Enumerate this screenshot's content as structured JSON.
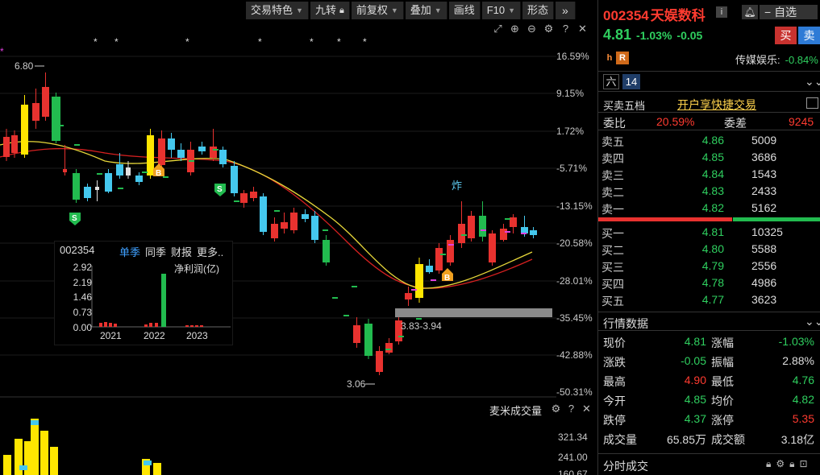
{
  "toolbar": {
    "items": [
      {
        "label": "交易特色",
        "caret": true
      },
      {
        "label": "九转",
        "icon": "lock-icon"
      },
      {
        "label": "前复权",
        "caret": true
      },
      {
        "label": "叠加",
        "caret": true
      },
      {
        "label": "画线",
        "caret": false
      },
      {
        "label": "F10",
        "caret": true
      },
      {
        "label": "形态",
        "caret": false
      }
    ],
    "more": "»"
  },
  "chart": {
    "price_axis": [
      "16.59%",
      "9.15%",
      "1.72%",
      "-5.71%",
      "-13.15%",
      "-20.58%",
      "-28.01%",
      "-35.45%",
      "-42.88%",
      "-50.31%"
    ],
    "high_label": "6.80",
    "low_label": "3.06",
    "range_label": "3.83-3.94",
    "zha_label": "炸",
    "b_label": "B",
    "s_label": "S",
    "volume_title": "麦米成交量",
    "volume_axis": [
      "321.34",
      "241.00",
      "160.67"
    ]
  },
  "fundamentals": {
    "code": "002354",
    "tabs": [
      "单季",
      "同季",
      "财报",
      "更多.."
    ],
    "active_tab": 0,
    "unit": "净利润(亿)",
    "y_ticks": [
      "2.92",
      "2.19",
      "1.46",
      "0.73",
      "0.00"
    ],
    "years": [
      "2021",
      "2022",
      "2023"
    ]
  },
  "stock": {
    "code": "002354",
    "name": "天娱数科",
    "info": "i",
    "watch_label": "自选",
    "price": "4.81",
    "change_pct": "-1.03%",
    "change": "-0.05",
    "buy_label": "买",
    "sell_label": "卖",
    "badge_h": "h",
    "badge_r": "R",
    "sector_label": "传媒娱乐:",
    "sector_value": "-0.84%",
    "liu_label": "六",
    "liu_value": "14"
  },
  "orderbook": {
    "title": "买卖五档",
    "link": "开户享快捷交易",
    "weibi_label": "委比",
    "weibi_value": "20.59%",
    "weicha_label": "委差",
    "weicha_value": "9245",
    "sells": [
      {
        "label": "卖五",
        "price": "4.86",
        "vol": "5009"
      },
      {
        "label": "卖四",
        "price": "4.85",
        "vol": "3686"
      },
      {
        "label": "卖三",
        "price": "4.84",
        "vol": "1543"
      },
      {
        "label": "卖二",
        "price": "4.83",
        "vol": "2433"
      },
      {
        "label": "卖一",
        "price": "4.82",
        "vol": "5162"
      }
    ],
    "buys": [
      {
        "label": "买一",
        "price": "4.81",
        "vol": "10325"
      },
      {
        "label": "买二",
        "price": "4.80",
        "vol": "5588"
      },
      {
        "label": "买三",
        "price": "4.79",
        "vol": "2556"
      },
      {
        "label": "买四",
        "price": "4.78",
        "vol": "4986"
      },
      {
        "label": "买五",
        "price": "4.77",
        "vol": "3623"
      }
    ],
    "split_buy_fraction": 0.6
  },
  "quote": {
    "title": "行情数据",
    "rows": [
      {
        "l1": "现价",
        "v1": "4.81",
        "c1": "green",
        "l2": "涨幅",
        "v2": "-1.03%",
        "c2": "green"
      },
      {
        "l1": "涨跌",
        "v1": "-0.05",
        "c1": "green",
        "l2": "振幅",
        "v2": "2.88%",
        "c2": "white"
      },
      {
        "l1": "最高",
        "v1": "4.90",
        "c1": "red",
        "l2": "最低",
        "v2": "4.76",
        "c2": "green"
      },
      {
        "l1": "今开",
        "v1": "4.85",
        "c1": "green",
        "l2": "均价",
        "v2": "4.82",
        "c2": "green"
      },
      {
        "l1": "跌停",
        "v1": "4.37",
        "c1": "green",
        "l2": "涨停",
        "v2": "5.35",
        "c2": "red"
      },
      {
        "l1": "成交量",
        "v1": "65.85万",
        "c1": "white",
        "l2": "成交额",
        "v2": "3.18亿",
        "c2": "white"
      }
    ],
    "fenshi_label": "分时成交"
  },
  "colors": {
    "up": "#ff3b30",
    "down": "#2fcf5f",
    "accent": "#3fa0ff",
    "link": "#ffd34d"
  }
}
